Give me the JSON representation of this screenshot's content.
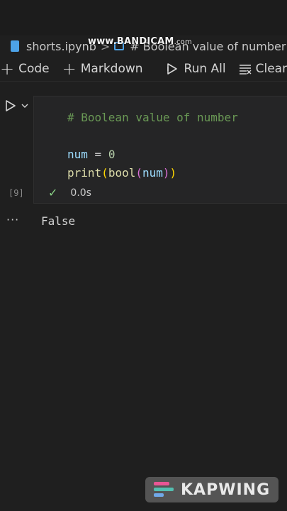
{
  "breadcrumb": {
    "file": "shorts.ipynb",
    "separator": ">",
    "cell": "# Boolean value of number"
  },
  "watermark_top": {
    "brand": "www.BANDICAM",
    "suffix": ".com"
  },
  "toolbar": {
    "code_label": "Code",
    "markdown_label": "Markdown",
    "run_all_label": "Run All",
    "clear_label": "Clear"
  },
  "cell": {
    "code_lines": [
      "# Boolean value of number",
      "",
      "num = 0",
      "print(bool(num))"
    ],
    "execution_count": "[9]",
    "status_time": "0.0s"
  },
  "output": {
    "more": "···",
    "text": "False"
  },
  "watermark_bottom": {
    "brand": "KAPWING"
  },
  "colors": {
    "background": "#1f1f1f",
    "cell_background": "#252526",
    "comment": "#6a9955",
    "variable": "#9cdcfe",
    "function": "#dcdcaa",
    "number": "#b5cea8",
    "success": "#89d185"
  }
}
